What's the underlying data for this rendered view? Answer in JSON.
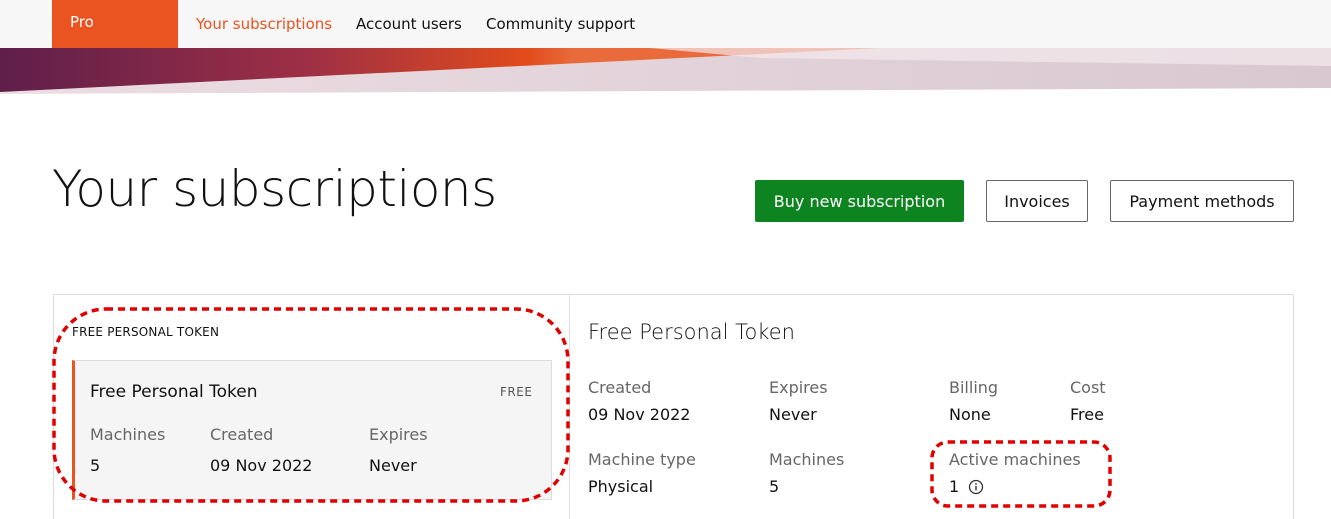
{
  "nav": {
    "brand": "Pro",
    "links": [
      "Your subscriptions",
      "Account users",
      "Community support"
    ]
  },
  "header": {
    "title": "Your subscriptions",
    "buttons": {
      "buy": "Buy new subscription",
      "invoices": "Invoices",
      "payment": "Payment methods"
    }
  },
  "list": {
    "group_label": "FREE PERSONAL TOKEN",
    "card": {
      "title": "Free Personal Token",
      "badge": "FREE",
      "fields": [
        {
          "label": "Machines",
          "value": "5"
        },
        {
          "label": "Created",
          "value": "09 Nov 2022"
        },
        {
          "label": "Expires",
          "value": "Never"
        }
      ]
    }
  },
  "details": {
    "title": "Free Personal Token",
    "fields": [
      {
        "label": "Created",
        "value": "09 Nov 2022"
      },
      {
        "label": "Expires",
        "value": "Never"
      },
      {
        "label": "Billing",
        "value": "None"
      },
      {
        "label": "Cost",
        "value": "Free"
      },
      {
        "label": "Machine type",
        "value": "Physical"
      },
      {
        "label": "Machines",
        "value": "5"
      },
      {
        "label": "Active machines",
        "value": "1"
      }
    ]
  },
  "colors": {
    "accent": "#e95420",
    "primary_button": "#0e8420",
    "annotation": "#e00000"
  }
}
